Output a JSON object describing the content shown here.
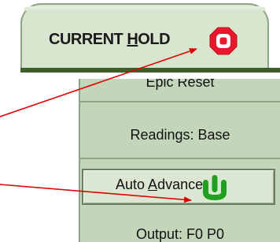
{
  "tab": {
    "label_prefix": "CURRENT ",
    "label_underlined": "H",
    "label_suffix": "OLD"
  },
  "panel": {
    "epic_reset_label": "Epic Reset",
    "readings_label": "Readings: Base",
    "auto_advance_prefix": "Auto ",
    "auto_advance_underlined": "A",
    "auto_advance_suffix": "dvance:",
    "output_label": "Output: F0 P0"
  },
  "icons": {
    "hold": "stop-octagon-icon",
    "auto_advance": "power-hand-icon"
  },
  "colors": {
    "tab_bg": "#d8e6cf",
    "panel_bg": "#c4d6ba",
    "stop_red": "#e8192c",
    "power_green": "#1fa01f",
    "arrow_red": "#e00000",
    "baseline": "#3f5f2a"
  }
}
